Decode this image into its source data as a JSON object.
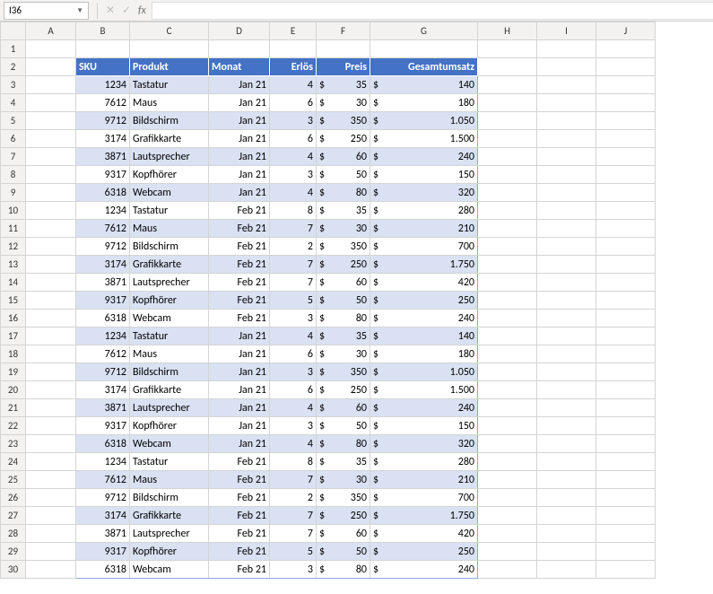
{
  "nameBox": "I36",
  "columns": [
    "A",
    "B",
    "C",
    "D",
    "E",
    "F",
    "G",
    "H",
    "I",
    "J"
  ],
  "headers": {
    "sku": "SKU",
    "produkt": "Produkt",
    "monat": "Monat",
    "erloes": "Erlös",
    "preis": "Preis",
    "gesamt": "Gesamtumsatz"
  },
  "currency": "$",
  "rows": [
    {
      "sku": "1234",
      "produkt": "Tastatur",
      "monat": "Jan 21",
      "erloes": "4",
      "preis": "35",
      "gesamt": "140",
      "band": true
    },
    {
      "sku": "7612",
      "produkt": "Maus",
      "monat": "Jan 21",
      "erloes": "6",
      "preis": "30",
      "gesamt": "180",
      "band": false
    },
    {
      "sku": "9712",
      "produkt": "Bildschirm",
      "monat": "Jan 21",
      "erloes": "3",
      "preis": "350",
      "gesamt": "1.050",
      "band": true
    },
    {
      "sku": "3174",
      "produkt": "Grafikkarte",
      "monat": "Jan 21",
      "erloes": "6",
      "preis": "250",
      "gesamt": "1.500",
      "band": false
    },
    {
      "sku": "3871",
      "produkt": "Lautsprecher",
      "monat": "Jan 21",
      "erloes": "4",
      "preis": "60",
      "gesamt": "240",
      "band": true
    },
    {
      "sku": "9317",
      "produkt": "Kopfhörer",
      "monat": "Jan 21",
      "erloes": "3",
      "preis": "50",
      "gesamt": "150",
      "band": false
    },
    {
      "sku": "6318",
      "produkt": "Webcam",
      "monat": "Jan 21",
      "erloes": "4",
      "preis": "80",
      "gesamt": "320",
      "band": true
    },
    {
      "sku": "1234",
      "produkt": "Tastatur",
      "monat": "Feb 21",
      "erloes": "8",
      "preis": "35",
      "gesamt": "280",
      "band": false
    },
    {
      "sku": "7612",
      "produkt": "Maus",
      "monat": "Feb 21",
      "erloes": "7",
      "preis": "30",
      "gesamt": "210",
      "band": true
    },
    {
      "sku": "9712",
      "produkt": "Bildschirm",
      "monat": "Feb 21",
      "erloes": "2",
      "preis": "350",
      "gesamt": "700",
      "band": false
    },
    {
      "sku": "3174",
      "produkt": "Grafikkarte",
      "monat": "Feb 21",
      "erloes": "7",
      "preis": "250",
      "gesamt": "1.750",
      "band": true
    },
    {
      "sku": "3871",
      "produkt": "Lautsprecher",
      "monat": "Feb 21",
      "erloes": "7",
      "preis": "60",
      "gesamt": "420",
      "band": false
    },
    {
      "sku": "9317",
      "produkt": "Kopfhörer",
      "monat": "Feb 21",
      "erloes": "5",
      "preis": "50",
      "gesamt": "250",
      "band": true
    },
    {
      "sku": "6318",
      "produkt": "Webcam",
      "monat": "Feb 21",
      "erloes": "3",
      "preis": "80",
      "gesamt": "240",
      "band": false
    },
    {
      "sku": "1234",
      "produkt": "Tastatur",
      "monat": "Jan 21",
      "erloes": "4",
      "preis": "35",
      "gesamt": "140",
      "band": true
    },
    {
      "sku": "7612",
      "produkt": "Maus",
      "monat": "Jan 21",
      "erloes": "6",
      "preis": "30",
      "gesamt": "180",
      "band": false
    },
    {
      "sku": "9712",
      "produkt": "Bildschirm",
      "monat": "Jan 21",
      "erloes": "3",
      "preis": "350",
      "gesamt": "1.050",
      "band": true
    },
    {
      "sku": "3174",
      "produkt": "Grafikkarte",
      "monat": "Jan 21",
      "erloes": "6",
      "preis": "250",
      "gesamt": "1.500",
      "band": false
    },
    {
      "sku": "3871",
      "produkt": "Lautsprecher",
      "monat": "Jan 21",
      "erloes": "4",
      "preis": "60",
      "gesamt": "240",
      "band": true
    },
    {
      "sku": "9317",
      "produkt": "Kopfhörer",
      "monat": "Jan 21",
      "erloes": "3",
      "preis": "50",
      "gesamt": "150",
      "band": false
    },
    {
      "sku": "6318",
      "produkt": "Webcam",
      "monat": "Jan 21",
      "erloes": "4",
      "preis": "80",
      "gesamt": "320",
      "band": true
    },
    {
      "sku": "1234",
      "produkt": "Tastatur",
      "monat": "Feb 21",
      "erloes": "8",
      "preis": "35",
      "gesamt": "280",
      "band": false
    },
    {
      "sku": "7612",
      "produkt": "Maus",
      "monat": "Feb 21",
      "erloes": "7",
      "preis": "30",
      "gesamt": "210",
      "band": true
    },
    {
      "sku": "9712",
      "produkt": "Bildschirm",
      "monat": "Feb 21",
      "erloes": "2",
      "preis": "350",
      "gesamt": "700",
      "band": false
    },
    {
      "sku": "3174",
      "produkt": "Grafikkarte",
      "monat": "Feb 21",
      "erloes": "7",
      "preis": "250",
      "gesamt": "1.750",
      "band": true
    },
    {
      "sku": "3871",
      "produkt": "Lautsprecher",
      "monat": "Feb 21",
      "erloes": "7",
      "preis": "60",
      "gesamt": "420",
      "band": false
    },
    {
      "sku": "9317",
      "produkt": "Kopfhörer",
      "monat": "Feb 21",
      "erloes": "5",
      "preis": "50",
      "gesamt": "250",
      "band": true
    },
    {
      "sku": "6318",
      "produkt": "Webcam",
      "monat": "Feb 21",
      "erloes": "3",
      "preis": "80",
      "gesamt": "240",
      "band": false
    }
  ]
}
